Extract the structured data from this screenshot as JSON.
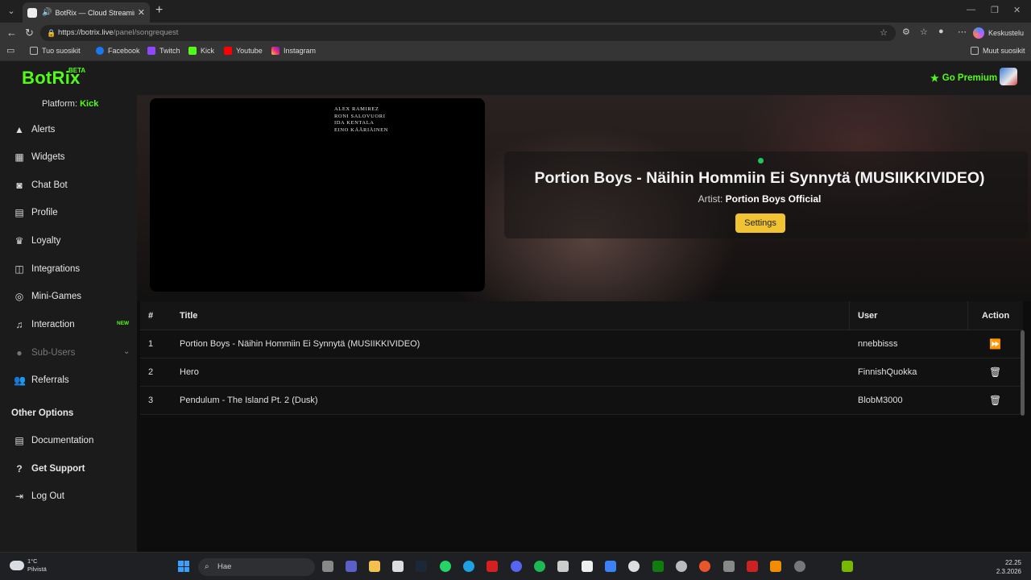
{
  "browser": {
    "tab_title": "BotRix — Cloud Streaming Bot",
    "url_host": "https://botrix.live",
    "url_path": "/panel/songrequest",
    "copilot_label": "Keskustelu",
    "bookmarks": [
      "Tuo suosikit",
      "Facebook",
      "Twitch",
      "Kick",
      "Youtube",
      "Instagram"
    ],
    "other_bookmarks": "Muut suosikit"
  },
  "header": {
    "brand": "BotRix",
    "beta": "BETA",
    "premium_label": "Go Premium"
  },
  "sidebar": {
    "platform_label": "Platform:",
    "platform_value": "Kick",
    "items": [
      {
        "label": "Alerts",
        "icon": "warning-icon"
      },
      {
        "label": "Widgets",
        "icon": "grid-icon"
      },
      {
        "label": "Chat Bot",
        "icon": "robot-icon"
      },
      {
        "label": "Profile",
        "icon": "id-card-icon"
      },
      {
        "label": "Loyalty",
        "icon": "trophy-icon"
      },
      {
        "label": "Integrations",
        "icon": "plug-icon"
      },
      {
        "label": "Mini-Games",
        "icon": "gamepad-icon"
      },
      {
        "label": "Interaction",
        "icon": "music-icon",
        "badge": "NEW"
      },
      {
        "label": "Sub-Users",
        "icon": "users-icon"
      },
      {
        "label": "Referrals",
        "icon": "user-group-icon"
      }
    ],
    "other_options_heading": "Other Options",
    "other_items": [
      {
        "label": "Documentation",
        "icon": "book-icon"
      },
      {
        "label": "Get Support",
        "icon": "question-icon"
      },
      {
        "label": "Log Out",
        "icon": "logout-icon"
      }
    ]
  },
  "player": {
    "credits": [
      "ALEX RAMIREZ",
      "RONI SALOVUORI",
      "IDA KENTALA",
      "EINO KÄÄRIÄINEN"
    ],
    "song_title": "Portion Boys - Näihin Hommiin Ei Synnytä (MUSIIKKIVIDEO)",
    "artist_label": "Artist:",
    "artist_name": "Portion Boys Official",
    "settings_label": "Settings"
  },
  "queue": {
    "columns": [
      "#",
      "Title",
      "User",
      "Action"
    ],
    "rows": [
      {
        "num": "1",
        "title": "Portion Boys - Näihin Hommiin Ei Synnytä (MUSIIKKIVIDEO)",
        "user": "nnebbisss",
        "action_icon": "skip-forward-icon"
      },
      {
        "num": "2",
        "title": "Hero",
        "user": "FinnishQuokka",
        "action_icon": "trash-icon"
      },
      {
        "num": "3",
        "title": "Pendulum - The Island Pt. 2 (Dusk)",
        "user": "BlobM3000",
        "action_icon": "trash-icon"
      }
    ]
  },
  "taskbar": {
    "temperature": "1°C",
    "weather": "Pilvistä",
    "search_placeholder": "Hae",
    "time": "22.25",
    "date": "2.3.2026"
  }
}
